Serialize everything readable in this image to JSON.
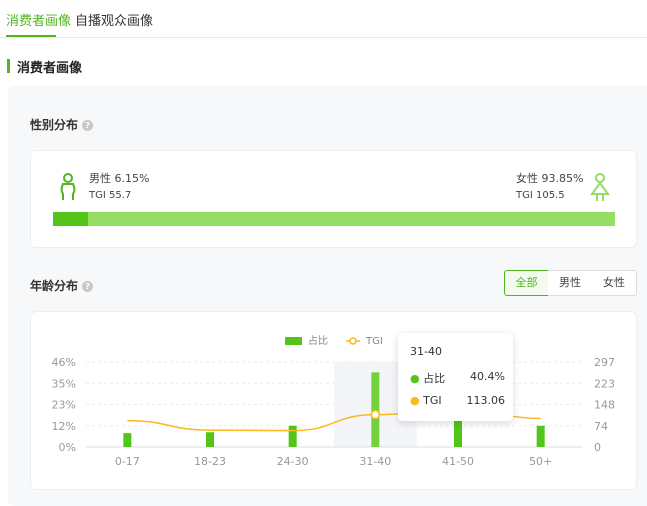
{
  "tabs": [
    {
      "label": "消费者画像",
      "active": true
    },
    {
      "label": "自播观众画像",
      "active": false
    }
  ],
  "section_title": "消费者画像",
  "gender": {
    "title": "性别分布",
    "help": "?",
    "male": {
      "label": "男性 6.15%",
      "tgi": "TGI 55.7",
      "share": 6.15
    },
    "female": {
      "label": "女性 93.85%",
      "tgi": "TGI 105.5",
      "share": 93.85
    }
  },
  "age": {
    "title": "年龄分布",
    "help": "?",
    "filters": [
      "全部",
      "男性",
      "女性"
    ],
    "active_filter": "全部"
  },
  "tooltip": {
    "category": "31-40",
    "share_label": "占比",
    "share_value": "40.4%",
    "tgi_label": "TGI",
    "tgi_value": "113.06"
  },
  "colors": {
    "accent": "#52b520",
    "bar": "#52c41a",
    "bar_light": "#95de64",
    "tgi": "#fab81d"
  },
  "chart_data": {
    "type": "bar",
    "categories": [
      "0-17",
      "18-23",
      "24-30",
      "31-40",
      "41-50",
      "50+"
    ],
    "series": [
      {
        "name": "占比",
        "type": "bar",
        "axis": "left",
        "values": [
          7.5,
          8,
          11.5,
          40.4,
          21,
          11.5
        ]
      },
      {
        "name": "TGI",
        "type": "line",
        "axis": "right",
        "values": [
          92,
          59,
          57,
          113.06,
          135,
          100
        ]
      }
    ],
    "yleft_ticks": [
      "0%",
      "12%",
      "23%",
      "35%",
      "46%"
    ],
    "yleft_range": [
      0,
      46
    ],
    "yright_ticks": [
      "0",
      "74",
      "148",
      "223",
      "297"
    ],
    "yright_range": [
      0,
      297
    ],
    "highlighted": "31-40",
    "legend": "top"
  }
}
